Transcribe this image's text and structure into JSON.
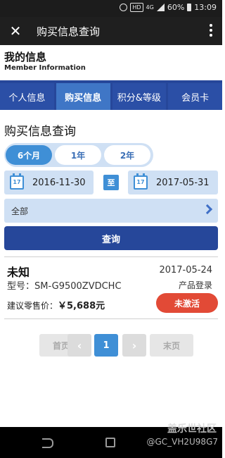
{
  "status_bar": {
    "hd": "HD",
    "network": "4G",
    "battery": "60%",
    "time": "13:09"
  },
  "app_bar": {
    "title": "购买信息查询"
  },
  "member": {
    "title": "我的信息",
    "subtitle": "Member Information"
  },
  "tabs": [
    {
      "label": "个人信息",
      "active": false
    },
    {
      "label": "购买信息",
      "active": true
    },
    {
      "label": "积分&等级",
      "active": false
    },
    {
      "label": "会员卡",
      "active": false
    }
  ],
  "section_title": "购买信息查询",
  "period": {
    "options": [
      "6个月",
      "1年",
      "2年"
    ],
    "selected": "6个月"
  },
  "dates": {
    "start": "2016-11-30",
    "separator": "至",
    "end": "2017-05-31",
    "calendar_icon_text": "17"
  },
  "category": {
    "value": "全部"
  },
  "query_button": "查询",
  "result": {
    "name": "未知",
    "date": "2017-05-24",
    "model": "型号：SM-G9500ZVDCHC",
    "type": "产品登录",
    "price_label": "建议零售价：",
    "price_value": "￥5,688元",
    "status": "未激活"
  },
  "pagination": {
    "first": "首页",
    "prev": "‹",
    "current": "1",
    "next": "›",
    "last": "末页"
  },
  "watermark": {
    "line1": "盖乐世社区",
    "line2": "@GC_VH2U98G7"
  },
  "colors": {
    "primary_dark": "#26479a",
    "accent_blue": "#3f8fd6",
    "light_blue": "#cfe0f4",
    "status_red": "#e24a36"
  }
}
